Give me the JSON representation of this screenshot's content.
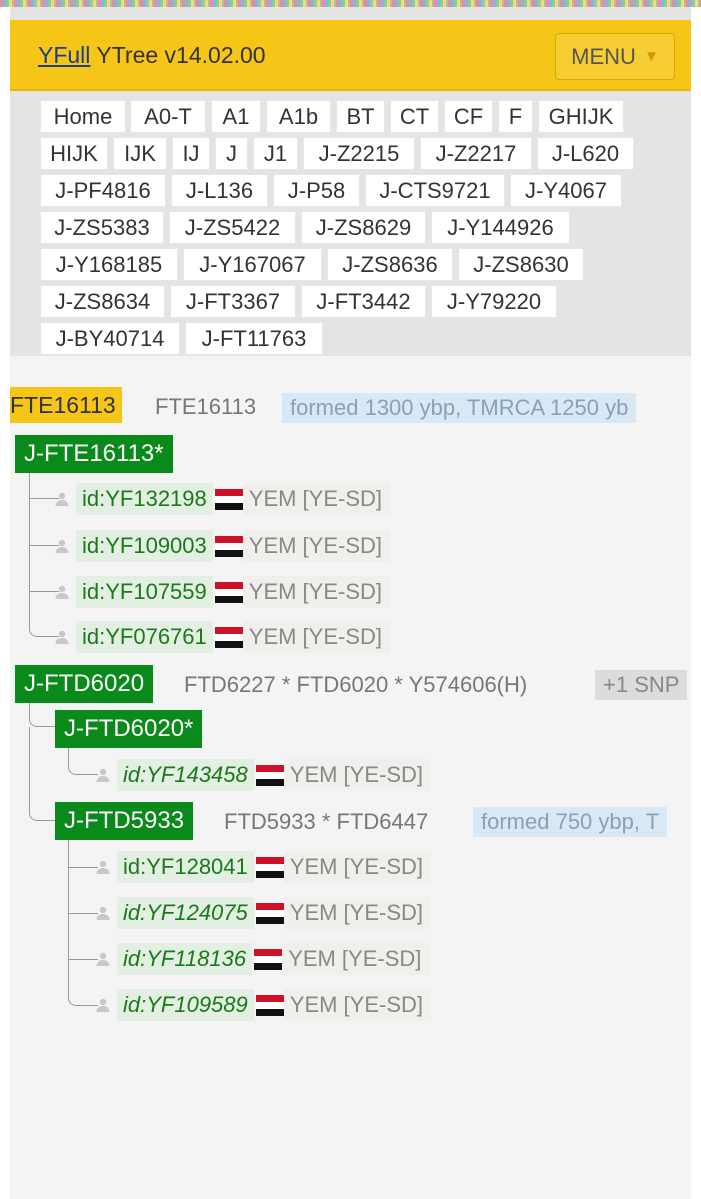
{
  "header": {
    "brand_link": "YFull",
    "brand_rest": " YTree v14.02.00",
    "menu_label": "MENU",
    "menu_caret": "▼"
  },
  "nav_tabs": [
    "Home",
    "A0-T",
    "A1",
    "A1b",
    "BT",
    "CT",
    "CF",
    "F",
    "GHIJK",
    "HIJK",
    "IJK",
    "IJ",
    "J",
    "J1",
    "J-Z2215",
    "J-Z2217",
    "J-L620",
    "J-PF4816",
    "J-L136",
    "J-P58",
    "J-CTS9721",
    "J-Y4067",
    "J-ZS5383",
    "J-ZS5422",
    "J-ZS8629",
    "J-Y144926",
    "J-Y168185",
    "J-Y167067",
    "J-ZS8636",
    "J-ZS8630",
    "J-ZS8634",
    "J-FT3367",
    "J-FT3442",
    "J-Y79220",
    "J-BY40714",
    "J-FT11763"
  ],
  "tree": {
    "root": {
      "name": "FTE16113",
      "snps": "FTE16113",
      "formed": "formed 1300 ybp, TMRCA 1250 yb"
    },
    "star_clade": {
      "name": "J-FTE16113*",
      "samples": [
        {
          "id": "id:YF132198",
          "country": "YEM [YE-SD]"
        },
        {
          "id": "id:YF109003",
          "country": "YEM [YE-SD]"
        },
        {
          "id": "id:YF107559",
          "country": "YEM [YE-SD]"
        },
        {
          "id": "id:YF076761",
          "country": "YEM [YE-SD]"
        }
      ]
    },
    "ftd6020": {
      "name": "J-FTD6020",
      "snps": "FTD6227 * FTD6020 * Y574606(H)",
      "badge": "+1 SNP",
      "star": {
        "name": "J-FTD6020*",
        "samples": [
          {
            "id": "id:YF143458",
            "country": "YEM [YE-SD]"
          }
        ]
      },
      "ftd5933": {
        "name": "J-FTD5933",
        "snps": "FTD5933 * FTD6447",
        "formed": "formed 750 ybp, T",
        "samples": [
          {
            "id": "id:YF128041",
            "country": "YEM [YE-SD]"
          },
          {
            "id": "id:YF124075",
            "country": "YEM [YE-SD]"
          },
          {
            "id": "id:YF118136",
            "country": "YEM [YE-SD]"
          },
          {
            "id": "id:YF109589",
            "country": "YEM [YE-SD]"
          }
        ]
      }
    }
  },
  "colors": {
    "header": "#f5c518",
    "clade": "#0a8a1a",
    "sample_id": "#1a7a1a",
    "formed_bg": "#d9e8f5"
  },
  "icons": {
    "person": "person-icon",
    "flag": "yemen-flag-icon"
  }
}
